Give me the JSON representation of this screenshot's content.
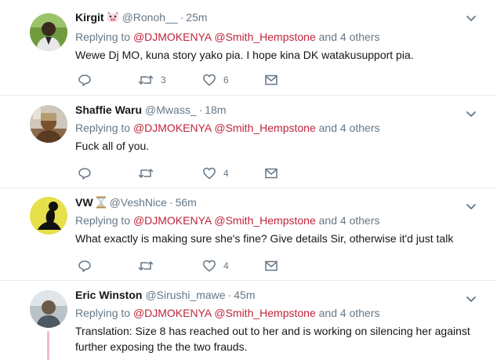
{
  "tweets": [
    {
      "name": "Kirgit",
      "handle": "@Ronoh__",
      "separator": "·",
      "time": "25m",
      "reply_prefix": "Replying to",
      "mention1": "@DJMOKENYA",
      "mention2": "@Smith_Hempstone",
      "reply_suffix": "and 4 others",
      "text": "Wewe Dj MO, kuna story yako pia. I hope kina DK watakusupport pia.",
      "retweets": "3",
      "likes": "6"
    },
    {
      "name": "Shaffie Waru",
      "handle": "@Mwass_",
      "separator": "·",
      "time": "18m",
      "reply_prefix": "Replying to",
      "mention1": "@DJMOKENYA",
      "mention2": "@Smith_Hempstone",
      "reply_suffix": "and 4 others",
      "text": "Fuck all of you.",
      "retweets": "",
      "likes": "4"
    },
    {
      "name": "VW",
      "handle": "@VeshNice",
      "separator": "·",
      "time": "56m",
      "reply_prefix": "Replying to",
      "mention1": "@DJMOKENYA",
      "mention2": "@Smith_Hempstone",
      "reply_suffix": "and 4 others",
      "text": "What exactly is making sure she's fine? Give details Sir, otherwise it'd just talk",
      "retweets": "",
      "likes": "4"
    },
    {
      "name": "Eric Winston",
      "handle": "@Sirushi_mawe",
      "separator": "·",
      "time": "45m",
      "reply_prefix": "Replying to",
      "mention1": "@DJMOKENYA",
      "mention2": "@Smith_Hempstone",
      "reply_suffix": "and 4 others",
      "text": "Translation: Size 8 has reached out to her and is working on silencing her against further exposing the the two frauds."
    }
  ],
  "icons": {
    "name_emoji_1": "cow-face-emoji",
    "name_emoji_3": "hourglass-emoji",
    "reply": "reply-icon",
    "retweet": "retweet-icon",
    "like": "heart-icon",
    "dm": "envelope-icon",
    "more": "chevron-down-icon"
  },
  "colors": {
    "mention": "#c0243b",
    "secondary_text": "#657786",
    "thread_line": "#f5b8d2"
  }
}
